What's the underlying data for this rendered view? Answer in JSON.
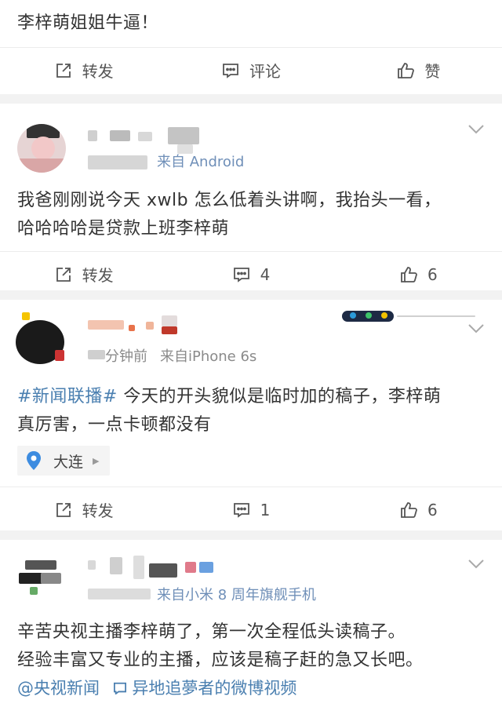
{
  "posts": [
    {
      "text": "李梓萌姐姐牛逼！",
      "actions": {
        "repost": "转发",
        "comment": "评论",
        "like": "赞"
      }
    },
    {
      "source": "来自 Android",
      "text_line1": "我爸刚刚说今天 xwlb 怎么低着头讲啊，我抬头一看，",
      "text_line2": "哈哈哈哈是贷款上班李梓萌",
      "actions": {
        "repost": "转发",
        "comment": "4",
        "like": "6"
      }
    },
    {
      "time": "分钟前",
      "source": "来自iPhone 6s",
      "topic": "#新闻联播#",
      "text_line1_rest": " 今天的开头貌似是临时加的稿子，李梓萌",
      "text_line2": "真厉害，一点卡顿都没有",
      "location": "大连",
      "actions": {
        "repost": "转发",
        "comment": "1",
        "like": "6"
      }
    },
    {
      "source": "来自小米 8 周年旗舰手机",
      "text_line1": "辛苦央视主播李梓萌了，第一次全程低头读稿子。",
      "text_line2": "经验丰富又专业的主播，应该是稿子赶的急又长吧。",
      "mention": "@央视新闻",
      "video_link": "异地追夢者的微博视频"
    }
  ],
  "colors": {
    "link": "#4a7fb0",
    "meta": "#8a8a8a",
    "divider": "#f2f2f2"
  }
}
